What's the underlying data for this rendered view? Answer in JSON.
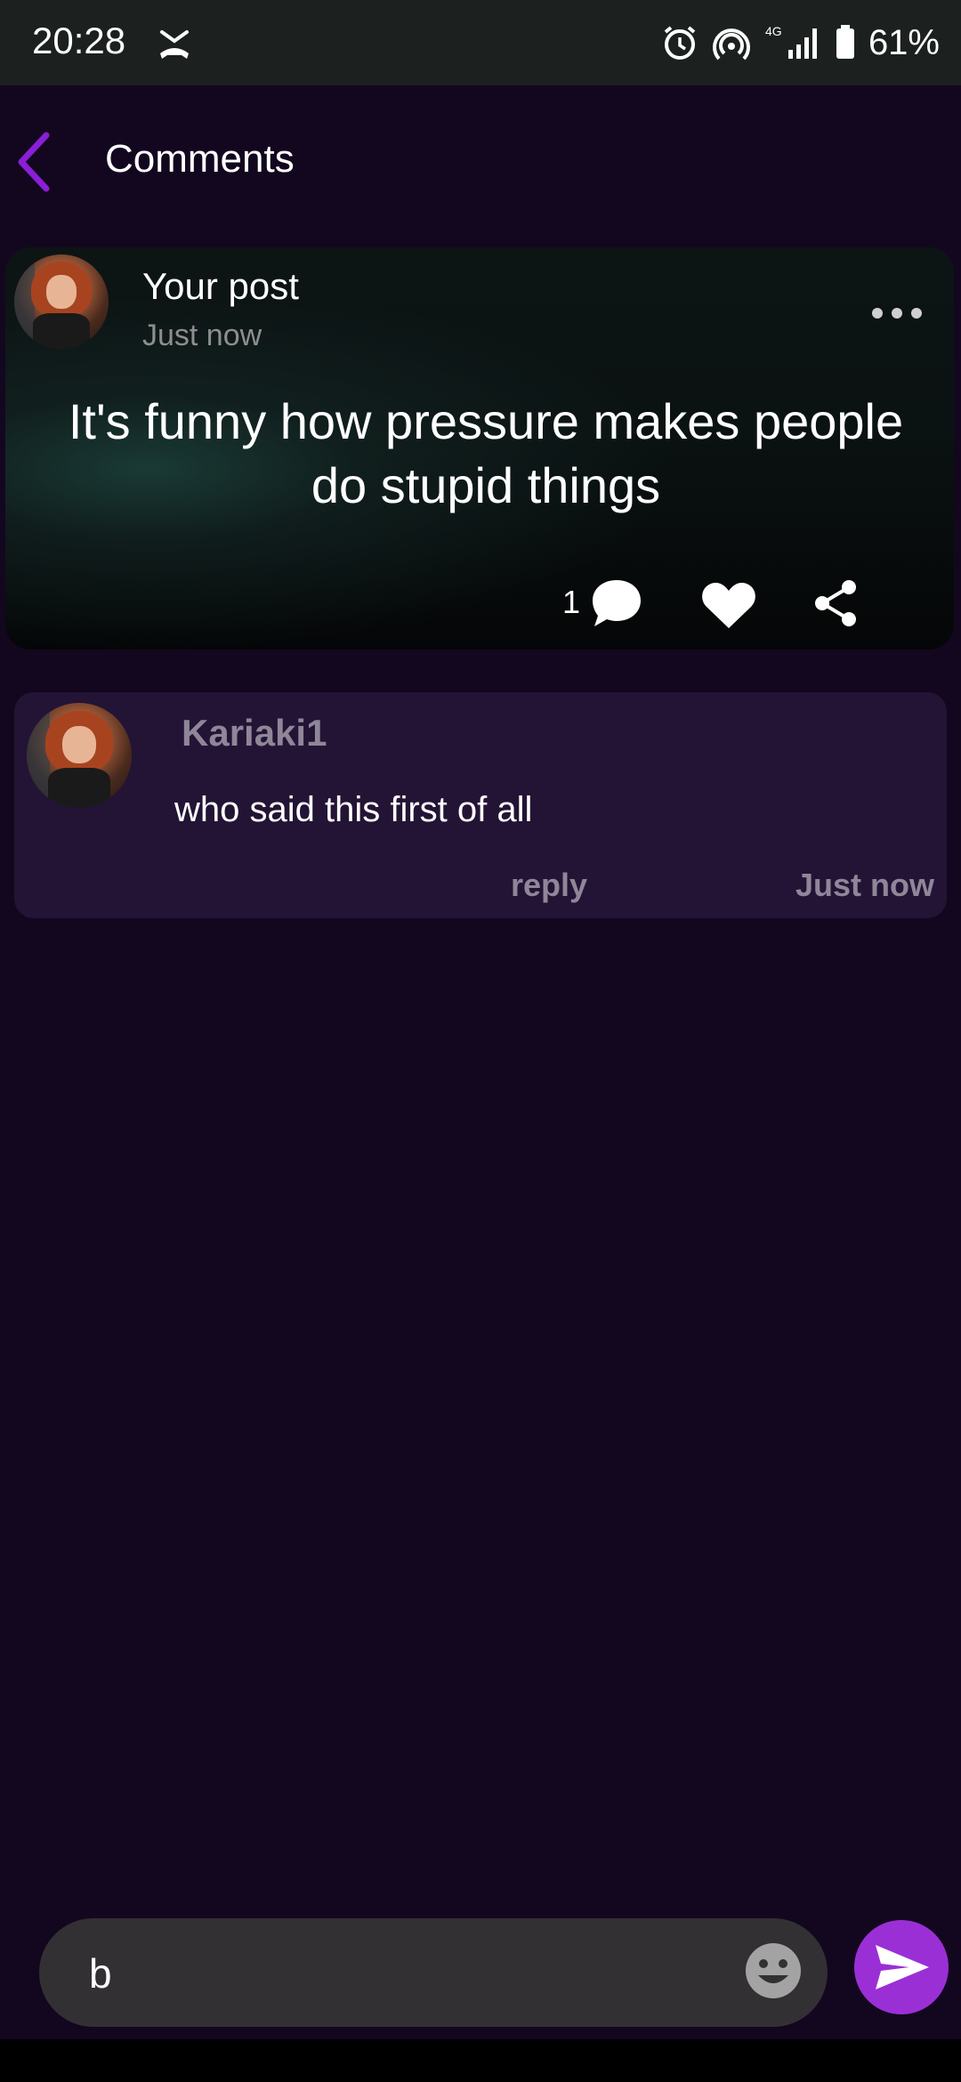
{
  "status_bar": {
    "time": "20:28",
    "network_label": "4G",
    "battery_percent": "61%"
  },
  "app_bar": {
    "title": "Comments"
  },
  "post": {
    "author_label": "Your post",
    "timestamp": "Just now",
    "text": "It's funny how pressure makes people do stupid things",
    "comment_count": "1"
  },
  "comments": [
    {
      "username": "Kariaki1",
      "text": "who said this first of all",
      "reply_label": "reply",
      "timestamp": "Just now"
    }
  ],
  "composer": {
    "value": "b"
  },
  "colors": {
    "background": "#13071f",
    "accent": "#9b2fd6",
    "comment_card": "#231435",
    "muted_text": "#8f8699"
  },
  "icons": [
    "back-arrow-icon",
    "more-horizontal-icon",
    "comment-bubble-icon",
    "heart-icon",
    "share-icon",
    "emoji-icon",
    "send-icon",
    "alarm-icon",
    "hotspot-icon",
    "signal-icon",
    "battery-icon",
    "call-icon"
  ]
}
